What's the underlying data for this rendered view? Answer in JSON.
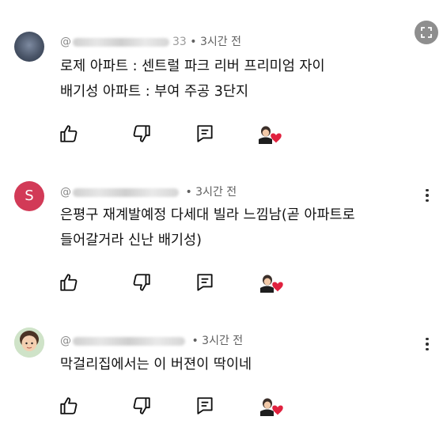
{
  "comments": [
    {
      "avatar": "photo-avatar",
      "handle_prefix": "@",
      "handle_suffix": "33",
      "time": "• 3시간 전",
      "lines": [
        "로제 아파트 : 센트럴 파크 리버 프리미엄 자이",
        "배기성 아파트 : 부여 주공 3단지"
      ]
    },
    {
      "avatar": "letter-avatar",
      "avatar_letter": "S",
      "avatar_color": "#d23a57",
      "handle_prefix": "@",
      "handle_suffix": "",
      "time": "• 3시간 전",
      "lines": [
        "은평구 재계발예정 다세대 빌라 느낌남(곧 아파트로",
        "들어갈거라 신난 배기성)"
      ]
    },
    {
      "avatar": "kid-photo-avatar",
      "handle_prefix": "@",
      "handle_suffix": "",
      "time": "• 3시간 전",
      "lines": [
        "막걸리집에서는 이 버젼이 딱이네"
      ]
    }
  ],
  "icons": {
    "like": "thumbs-up-icon",
    "dislike": "thumbs-down-icon",
    "reply": "reply-icon",
    "creator_heart": "creator-heart-icon",
    "more": "more-vert-icon",
    "expand": "expand-icon"
  },
  "colors": {
    "heart": "#e0213e",
    "meta_text": "#606060",
    "expand_button": "#8e8e8e"
  }
}
